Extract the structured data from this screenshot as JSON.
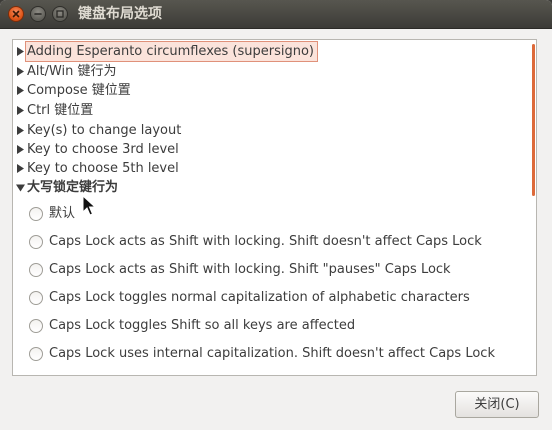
{
  "window": {
    "title": "键盘布局选项"
  },
  "tree": {
    "items": [
      {
        "label": "Adding Esperanto circumflexes (supersigno)",
        "expanded": false,
        "selected": true
      },
      {
        "label": "Alt/Win 键行为",
        "expanded": false
      },
      {
        "label": "Compose 键位置",
        "expanded": false
      },
      {
        "label": "Ctrl 键位置",
        "expanded": false
      },
      {
        "label": "Key(s) to change layout",
        "expanded": false
      },
      {
        "label": "Key to choose 3rd level",
        "expanded": false
      },
      {
        "label": "Key to choose 5th level",
        "expanded": false
      },
      {
        "label": "大写锁定键行为",
        "expanded": true
      }
    ],
    "options": [
      {
        "label": "默认",
        "checked": false
      },
      {
        "label": "Caps Lock acts as Shift with locking. Shift doesn't affect Caps Lock",
        "checked": false
      },
      {
        "label": "Caps Lock acts as Shift with locking. Shift \"pauses\" Caps Lock",
        "checked": false
      },
      {
        "label": "Caps Lock toggles normal capitalization of alphabetic characters",
        "checked": false
      },
      {
        "label": "Caps Lock toggles Shift so all keys are affected",
        "checked": false
      },
      {
        "label": "Caps Lock uses internal capitalization. Shift doesn't affect Caps Lock",
        "checked": false
      }
    ]
  },
  "footer": {
    "close_label": "关闭(C)"
  },
  "colors": {
    "accent": "#dd6a3a",
    "selection_bg": "#fbe3db",
    "titlebar": "#3c3b37"
  }
}
